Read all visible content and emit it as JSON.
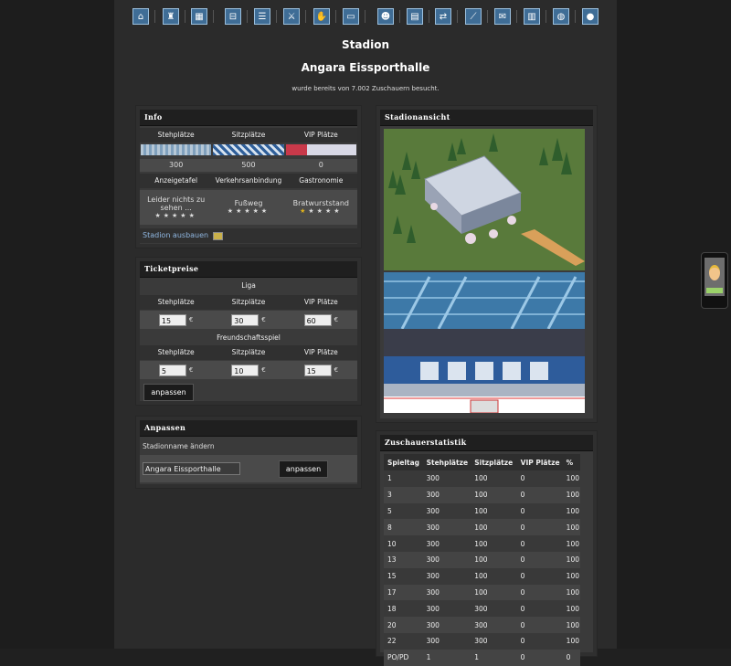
{
  "nav": {
    "items": [
      {
        "icon": "home-icon",
        "glyph": "⌂"
      },
      {
        "icon": "jersey-icon",
        "glyph": "♜"
      },
      {
        "icon": "lineup-icon",
        "glyph": "▦"
      },
      {
        "icon": "training-icon",
        "glyph": "⊟"
      },
      {
        "icon": "list-icon",
        "glyph": "☰"
      },
      {
        "icon": "versus-icon",
        "glyph": "⚔"
      },
      {
        "icon": "handshake-icon",
        "glyph": "✋"
      },
      {
        "icon": "rink-icon",
        "glyph": "▭"
      },
      {
        "icon": "staff-icon",
        "glyph": "☻"
      },
      {
        "icon": "finance-icon",
        "glyph": "▤"
      },
      {
        "icon": "transfer-icon",
        "glyph": "⇄"
      },
      {
        "icon": "stats-chart-icon",
        "glyph": "⟋"
      },
      {
        "icon": "mail-icon",
        "glyph": "✉"
      },
      {
        "icon": "news-icon",
        "glyph": "▥"
      },
      {
        "icon": "chat-icon",
        "glyph": "◍"
      },
      {
        "icon": "logout-icon",
        "glyph": "●"
      }
    ]
  },
  "page": {
    "section_title": "Stadion",
    "stadium_name": "Angara Eissporthalle",
    "visits_text": "wurde bereits von 7.002 Zuschauern besucht."
  },
  "info": {
    "title": "Info",
    "columns": [
      "Stehplätze",
      "Sitzplätze",
      "VIP Plätze"
    ],
    "capacities": [
      "300",
      "500",
      "0"
    ],
    "features": [
      "Anzeigetafel",
      "Verkehrsanbindung",
      "Gastronomie"
    ],
    "feature_values": [
      "Leider nichts zu sehen ...",
      "Fußweg",
      "Bratwurststand"
    ],
    "feature_stars": [
      0,
      0,
      1
    ],
    "expand_link": "Stadion ausbauen"
  },
  "tickets": {
    "title": "Ticketpreise",
    "liga_label": "Liga",
    "friendly_label": "Freundschaftsspiel",
    "columns": [
      "Stehplätze",
      "Sitzplätze",
      "VIP Plätze"
    ],
    "liga_prices": [
      "15",
      "30",
      "60"
    ],
    "friendly_prices": [
      "5",
      "10",
      "15"
    ],
    "currency": "€",
    "submit": "anpassen"
  },
  "rename": {
    "title": "Anpassen",
    "label": "Stadionname ändern",
    "value": "Angara Eissporthalle",
    "submit": "anpassen"
  },
  "view": {
    "title": "Stadionansicht"
  },
  "stats": {
    "title": "Zuschauerstatistik",
    "headers": [
      "Spieltag",
      "Stehplätze",
      "Sitzplätze",
      "VIP Plätze",
      "%"
    ],
    "rows": [
      [
        "1",
        "300",
        "100",
        "0",
        "100"
      ],
      [
        "3",
        "300",
        "100",
        "0",
        "100"
      ],
      [
        "5",
        "300",
        "100",
        "0",
        "100"
      ],
      [
        "8",
        "300",
        "100",
        "0",
        "100"
      ],
      [
        "10",
        "300",
        "100",
        "0",
        "100"
      ],
      [
        "13",
        "300",
        "100",
        "0",
        "100"
      ],
      [
        "15",
        "300",
        "100",
        "0",
        "100"
      ],
      [
        "17",
        "300",
        "100",
        "0",
        "100"
      ],
      [
        "18",
        "300",
        "300",
        "0",
        "100"
      ],
      [
        "20",
        "300",
        "300",
        "0",
        "100"
      ],
      [
        "22",
        "300",
        "300",
        "0",
        "100"
      ],
      [
        "PO/PD",
        "1",
        "1",
        "0",
        "0"
      ]
    ]
  },
  "colors": {
    "accent_blue": "#3f6d96",
    "star_on": "#e0b21b",
    "link": "#8fb6e0"
  }
}
